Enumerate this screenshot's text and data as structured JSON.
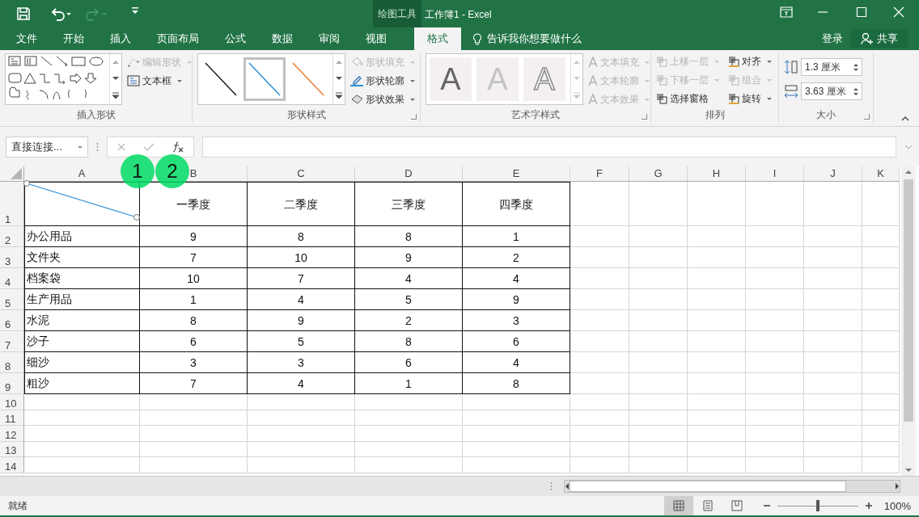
{
  "title_bar": {
    "context_label": "绘图工具",
    "title": "工作簿1 - Excel"
  },
  "tabs": [
    {
      "label": "文件",
      "selected": false
    },
    {
      "label": "开始",
      "selected": false
    },
    {
      "label": "插入",
      "selected": false
    },
    {
      "label": "页面布局",
      "selected": false
    },
    {
      "label": "公式",
      "selected": false
    },
    {
      "label": "数据",
      "selected": false
    },
    {
      "label": "审阅",
      "selected": false
    },
    {
      "label": "视图",
      "selected": false
    },
    {
      "label": "格式",
      "selected": true
    }
  ],
  "tell_me": "告诉我你想要做什么",
  "account": {
    "sign_in": "登录",
    "share": "共享"
  },
  "ribbon": {
    "insert_shapes": {
      "label": "插入形状",
      "commands": [
        {
          "label": "编辑形状",
          "disabled": true
        },
        {
          "label": "文本框",
          "disabled": false
        }
      ]
    },
    "shape_styles": {
      "label": "形状样式",
      "styles": [
        {
          "selected": false,
          "color": "#1a1a1a"
        },
        {
          "selected": true,
          "color": "#2e8fd6"
        },
        {
          "selected": false,
          "color": "#ed7d31"
        }
      ],
      "commands": [
        {
          "label": "形状填充",
          "disabled": true
        },
        {
          "label": "形状轮廓",
          "disabled": false
        },
        {
          "label": "形状效果",
          "disabled": false
        }
      ]
    },
    "wordart_styles": {
      "label": "艺术字样式",
      "styles": [
        {
          "kind": "solid",
          "text": "A"
        },
        {
          "kind": "light",
          "text": "A"
        },
        {
          "kind": "outline",
          "text": "A"
        }
      ],
      "commands": [
        {
          "label": "文本填充",
          "disabled": true
        },
        {
          "label": "文本轮廓",
          "disabled": true
        },
        {
          "label": "文本效果",
          "disabled": true
        }
      ]
    },
    "arrange": {
      "label": "排列",
      "commands": [
        {
          "label": "上移一层",
          "disabled": true
        },
        {
          "label": "下移一层",
          "disabled": true
        },
        {
          "label": "选择窗格",
          "disabled": false
        },
        {
          "label": "对齐",
          "disabled": false
        },
        {
          "label": "组合",
          "disabled": true
        },
        {
          "label": "旋转",
          "disabled": false
        }
      ]
    },
    "size": {
      "label": "大小",
      "fields": [
        {
          "kind": "height",
          "value": "1.3 厘米"
        },
        {
          "kind": "width",
          "value": "3.63 厘米"
        }
      ]
    }
  },
  "formula_bar": {
    "name_box": "直接连接..."
  },
  "sheet": {
    "columns": [
      "A",
      "B",
      "C",
      "D",
      "E",
      "F",
      "G",
      "H",
      "I",
      "J",
      "K"
    ],
    "rows": [
      {
        "header": "1",
        "cells": [
          "",
          "一季度",
          "二季度",
          "三季度",
          "四季度"
        ]
      },
      {
        "header": "2",
        "cells": [
          "办公用品",
          "9",
          "8",
          "8",
          "1"
        ]
      },
      {
        "header": "3",
        "cells": [
          "文件夹",
          "7",
          "10",
          "9",
          "2"
        ]
      },
      {
        "header": "4",
        "cells": [
          "档案袋",
          "10",
          "7",
          "4",
          "4"
        ]
      },
      {
        "header": "5",
        "cells": [
          "生产用品",
          "1",
          "4",
          "5",
          "9"
        ]
      },
      {
        "header": "6",
        "cells": [
          "水泥",
          "8",
          "9",
          "2",
          "3"
        ]
      },
      {
        "header": "7",
        "cells": [
          "沙子",
          "6",
          "5",
          "8",
          "6"
        ]
      },
      {
        "header": "8",
        "cells": [
          "细沙",
          "3",
          "3",
          "6",
          "4"
        ]
      },
      {
        "header": "9",
        "cells": [
          "粗沙",
          "7",
          "4",
          "1",
          "8"
        ]
      },
      {
        "header": "10",
        "cells": []
      },
      {
        "header": "11",
        "cells": []
      },
      {
        "header": "12",
        "cells": []
      },
      {
        "header": "13",
        "cells": []
      },
      {
        "header": "14",
        "cells": []
      }
    ]
  },
  "markers": [
    "1",
    "2"
  ],
  "status_bar": {
    "status": "就绪",
    "views": [
      {
        "selected": true
      },
      {
        "selected": false
      },
      {
        "selected": false
      }
    ],
    "zoom": {
      "level": 0.5
    },
    "zoom_label": "100%"
  }
}
